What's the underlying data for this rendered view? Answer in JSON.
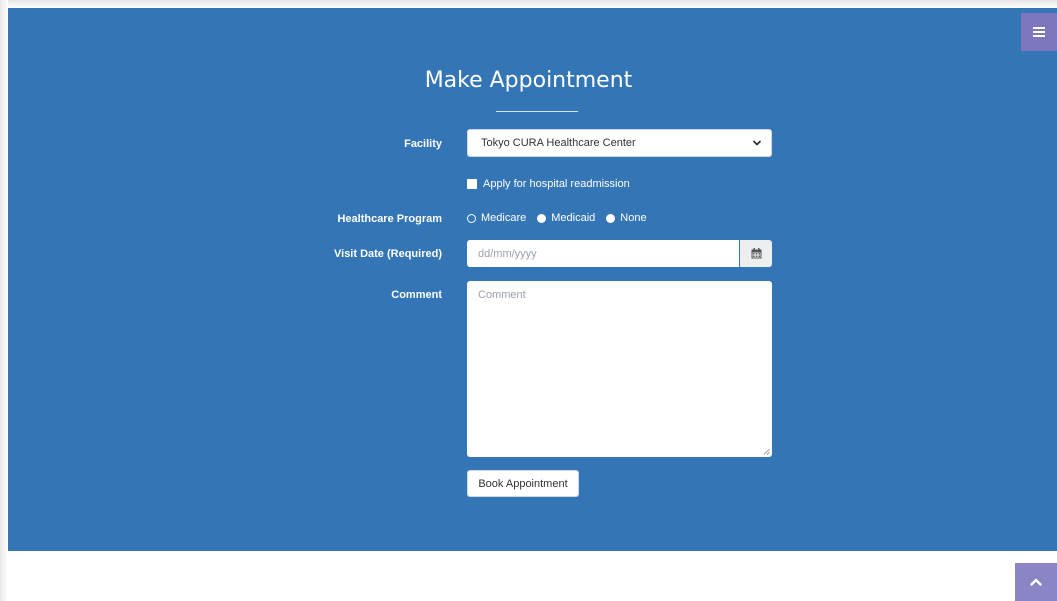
{
  "menu": {
    "icon": "hamburger-menu-icon"
  },
  "page": {
    "title": "Make Appointment"
  },
  "form": {
    "facility_label": "Facility",
    "facility_value": "Tokyo CURA Healthcare Center",
    "readmission_label": "Apply for hospital readmission",
    "readmission_checked": false,
    "program_label": "Healthcare Program",
    "programs": [
      {
        "label": "Medicare",
        "selected": true
      },
      {
        "label": "Medicaid",
        "selected": false
      },
      {
        "label": "None",
        "selected": false
      }
    ],
    "visit_date_label": "Visit Date (Required)",
    "visit_date_placeholder": "dd/mm/yyyy",
    "comment_label": "Comment",
    "comment_placeholder": "Comment",
    "book_button": "Book Appointment"
  },
  "colors": {
    "hero_bg": "#3375b5",
    "menu_button": "#7d77bf",
    "scroll_top_button": "#8a86c6"
  },
  "icons": {
    "select_caret": "chevron-down-icon",
    "calendar": "calendar-icon",
    "scroll_top": "chevron-up-icon"
  }
}
